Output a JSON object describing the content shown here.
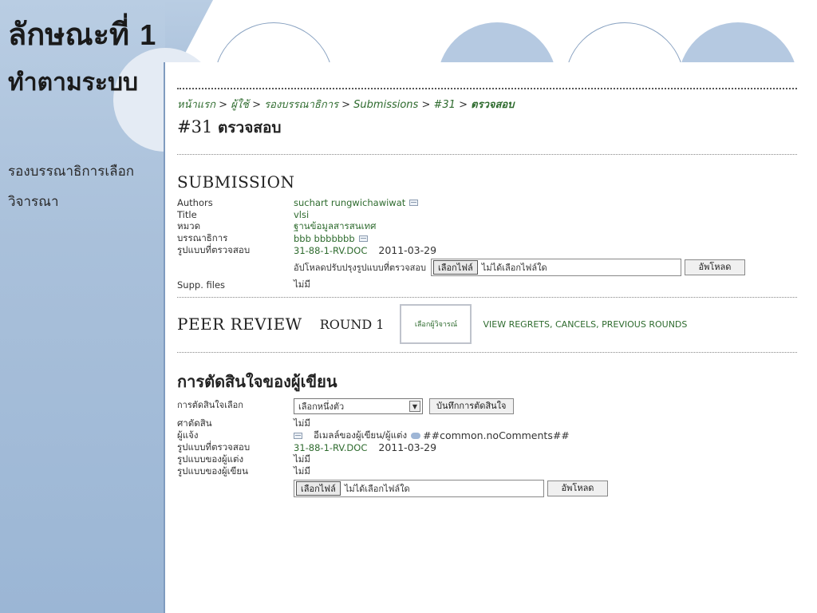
{
  "slide": {
    "title_text": "ลักษณะที่",
    "title_number": "1",
    "subtitle": "ทำตามระบบ",
    "body_lines": [
      "รองบรรณาธิการเลือก",
      "วิจารณา"
    ]
  },
  "breadcrumb": {
    "home": "หน้าแรก",
    "user": "ผู้ใช้",
    "section_editor": "รองบรรณาธิการ",
    "submissions": "Submissions",
    "id": "#31",
    "current": "ตรวจสอบ",
    "separator": ">"
  },
  "page": {
    "heading_number": "#31",
    "heading_text": "ตรวจสอบ"
  },
  "submission": {
    "title": "SUBMISSION",
    "rows": [
      {
        "label": "Authors",
        "value": "suchart rungwichawiwat"
      },
      {
        "label": "Title",
        "value": "vlsi"
      },
      {
        "label": "หมวด",
        "value": "ฐานข้อมูลสารสนเทศ"
      },
      {
        "label": "บรรณาธิการ",
        "value": "bbb bbbbbbb"
      },
      {
        "label": "รูปแบบที่ตรวจสอบ",
        "value": "31-88-1-RV.DOC",
        "date": "2011-03-29"
      }
    ],
    "upload_label": "อัปโหลดปรับปรุงรูปแบบที่ตรวจสอบ",
    "file_button": "เลือกไฟล์",
    "file_none": "ไม่ได้เลือกไฟล์ใด",
    "upload_button": "อัพโหลด",
    "supp_label": "Supp. files",
    "supp_value": "ไม่มี"
  },
  "peer_review": {
    "title": "PEER REVIEW",
    "round": "ROUND 1",
    "select_reviewer": "เลือกผู้วิจารณ์",
    "view_regrets": "VIEW REGRETS, CANCELS, PREVIOUS ROUNDS"
  },
  "decision": {
    "title": "การตัดสินใจของผู้เขียน",
    "select_label": "การตัดสินใจเลือก",
    "select_value": "เลือกหนึ่งตัว",
    "record_button": "บันทึกการตัดสินใจ",
    "rows": [
      {
        "label": "ศาตัดสิน",
        "value": "ไม่มี"
      },
      {
        "label": "ผู้แจ้ง",
        "value": "อีเมลล์ของผู้เขียน/ผู้แต่ง",
        "comment": "##common.noComments##"
      },
      {
        "label": "รูปแบบที่ตรวจสอบ",
        "value": "31-88-1-RV.DOC",
        "date": "2011-03-29"
      },
      {
        "label": "รูปแบบของผู้แต่ง",
        "value": "ไม่มี"
      },
      {
        "label": "รูปแบบของผู้เขียน",
        "value": "ไม่มี"
      }
    ],
    "file_button": "เลือกไฟล์",
    "file_none": "ไม่ได้เลือกไฟล์ใด",
    "upload_button": "อัพโหลด"
  },
  "colors": {
    "link_green": "#2e6b2e",
    "sidebar_blue": "#a9c0da"
  },
  "icons": [
    "mail-icon",
    "comment-icon",
    "select-arrow-icon"
  ]
}
